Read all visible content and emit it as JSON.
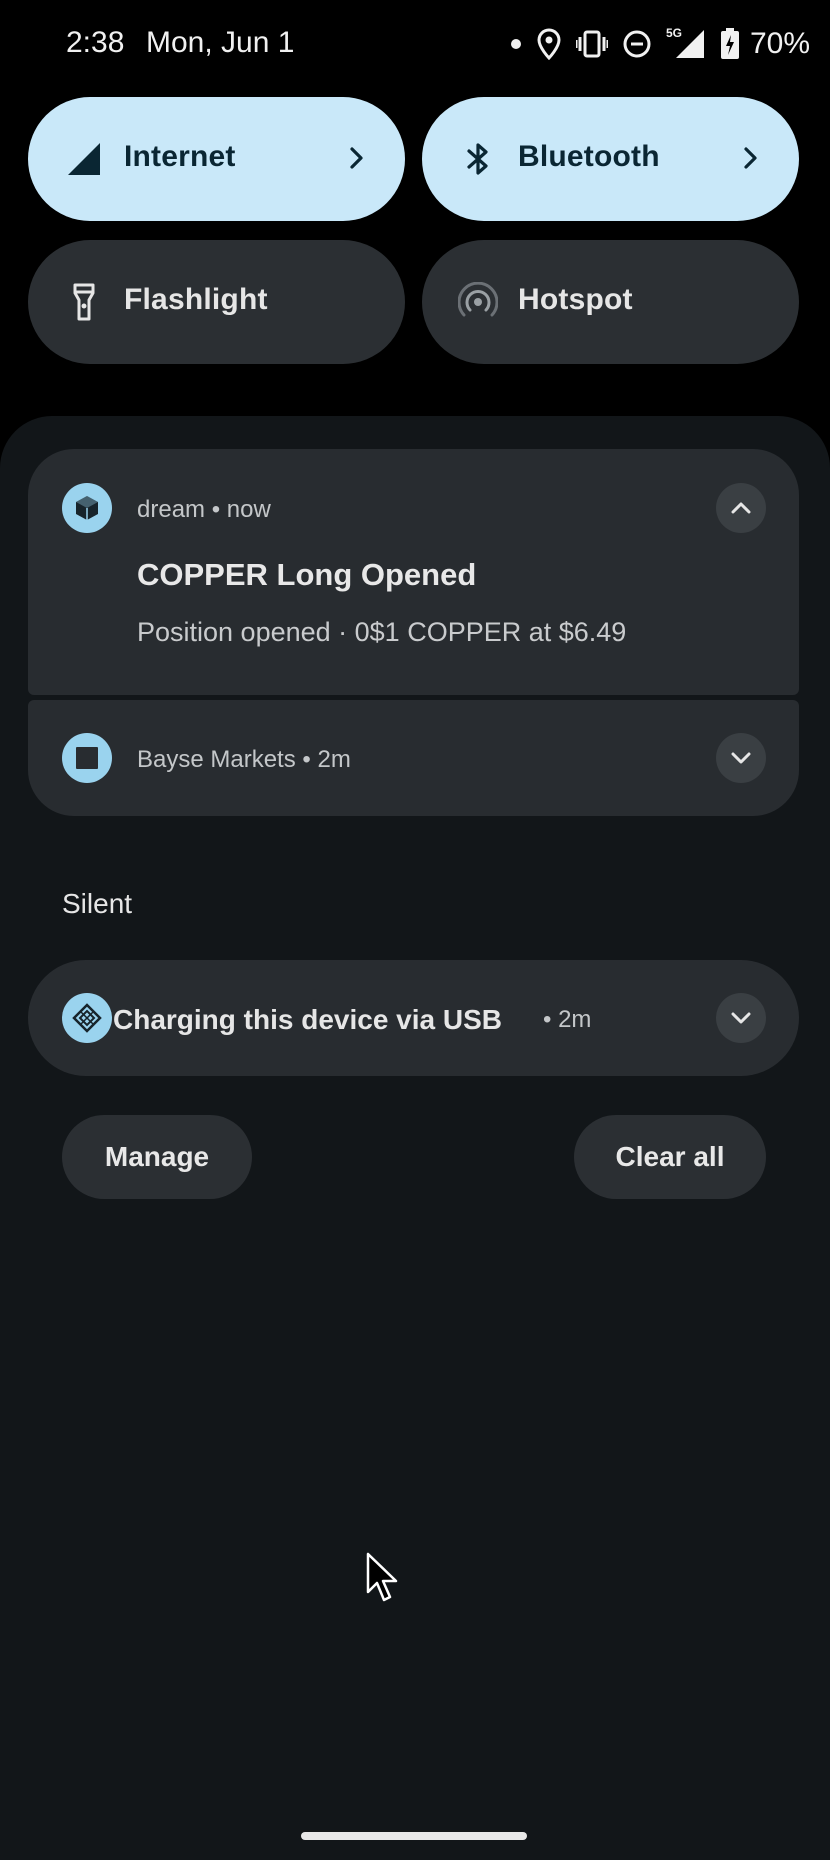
{
  "status_bar": {
    "time": "2:38",
    "date": "Mon, Jun 1",
    "network_label": "5G",
    "battery_percent": "70%",
    "icons": [
      "dot-icon",
      "location-icon",
      "vibrate-icon",
      "do-not-disturb-icon",
      "signal-5g-icon",
      "battery-charging-icon"
    ]
  },
  "quick_settings": {
    "tiles": [
      {
        "label": "Internet",
        "icon": "cellular-signal-icon",
        "active": true,
        "has_chevron": true
      },
      {
        "label": "Bluetooth",
        "icon": "bluetooth-icon",
        "active": true,
        "has_chevron": true
      },
      {
        "label": "Flashlight",
        "icon": "flashlight-icon",
        "active": false,
        "has_chevron": false
      },
      {
        "label": "Hotspot",
        "icon": "hotspot-icon",
        "active": false,
        "has_chevron": false
      }
    ],
    "active_color": "#c9e8f9",
    "inactive_color": "#2b2f33"
  },
  "notifications": [
    {
      "app": "dream",
      "time": "now",
      "title": "COPPER Long Opened",
      "text": "Position opened · 0$1 COPPER at $6.49",
      "expanded": true,
      "icon": "cube-icon"
    },
    {
      "app": "Bayse Markets",
      "time": "2m",
      "expanded": false,
      "icon": "square-app-icon"
    }
  ],
  "silent_section": {
    "label": "Silent",
    "notification": {
      "title": "Charging this device via USB",
      "time": "2m",
      "icon": "usb-icon"
    }
  },
  "buttons": {
    "manage": "Manage",
    "clear_all": "Clear all"
  },
  "theme": {
    "accent": "#9ad3ee",
    "shade_background": "#121619",
    "card_background": "#282c30"
  }
}
